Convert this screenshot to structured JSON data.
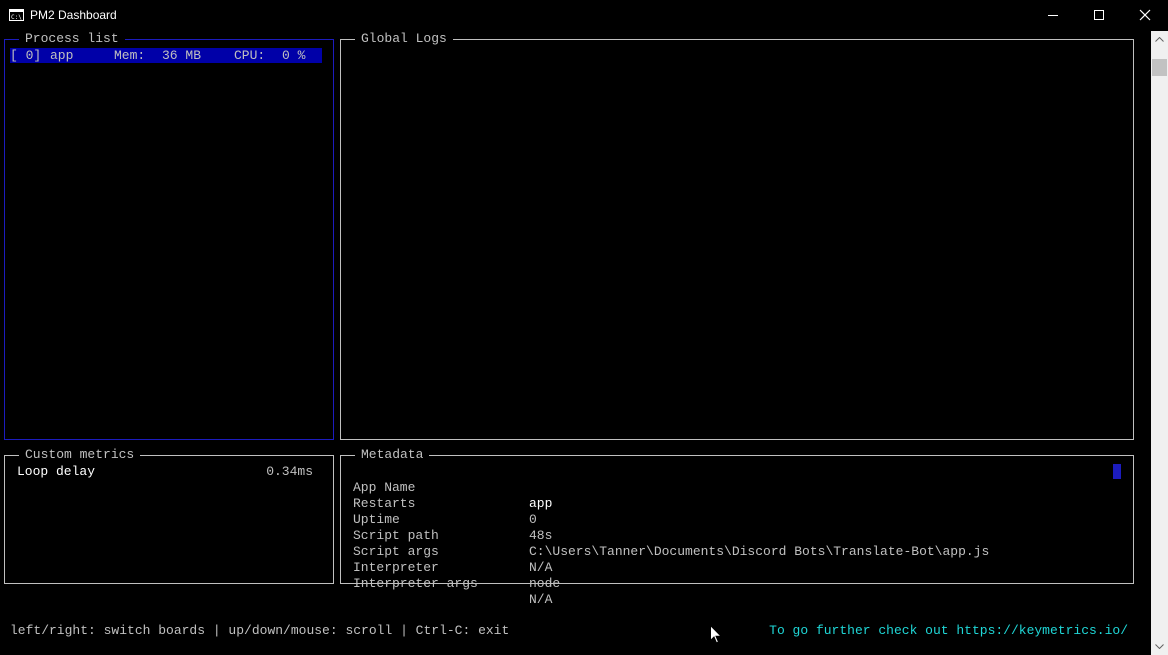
{
  "window": {
    "title": "PM2 Dashboard",
    "icon": "console-icon"
  },
  "process_list": {
    "label": "Process list",
    "items": [
      {
        "id": "[ 0]",
        "name": "app",
        "mem_label": "Mem:",
        "mem_value": "36 MB",
        "cpu_label": "CPU:",
        "cpu_value": "0 %",
        "selected": true
      }
    ]
  },
  "global_logs": {
    "label": "Global Logs"
  },
  "custom_metrics": {
    "label": "Custom metrics",
    "items": [
      {
        "name": "Loop delay",
        "value": "0.34ms"
      }
    ]
  },
  "metadata": {
    "label": "Metadata",
    "rows": [
      {
        "key": "App Name",
        "value": "app"
      },
      {
        "key": "Restarts",
        "value": "0"
      },
      {
        "key": "Uptime",
        "value": "48s"
      },
      {
        "key": "Script path",
        "value": "C:\\Users\\Tanner\\Documents\\Discord Bots\\Translate-Bot\\app.js"
      },
      {
        "key": "Script args",
        "value": "N/A"
      },
      {
        "key": "Interpreter",
        "value": "node"
      },
      {
        "key": "Interpreter args",
        "value": "N/A"
      }
    ]
  },
  "footer": {
    "help": "left/right: switch boards | up/down/mouse: scroll | Ctrl-C: exit",
    "promo": "To go further check out https://keymetrics.io/"
  },
  "colors": {
    "background": "#000000",
    "selection": "#0000a8",
    "border_active": "#1c1cbe",
    "text": "#c0c0c0",
    "link": "#1fd6d6"
  }
}
